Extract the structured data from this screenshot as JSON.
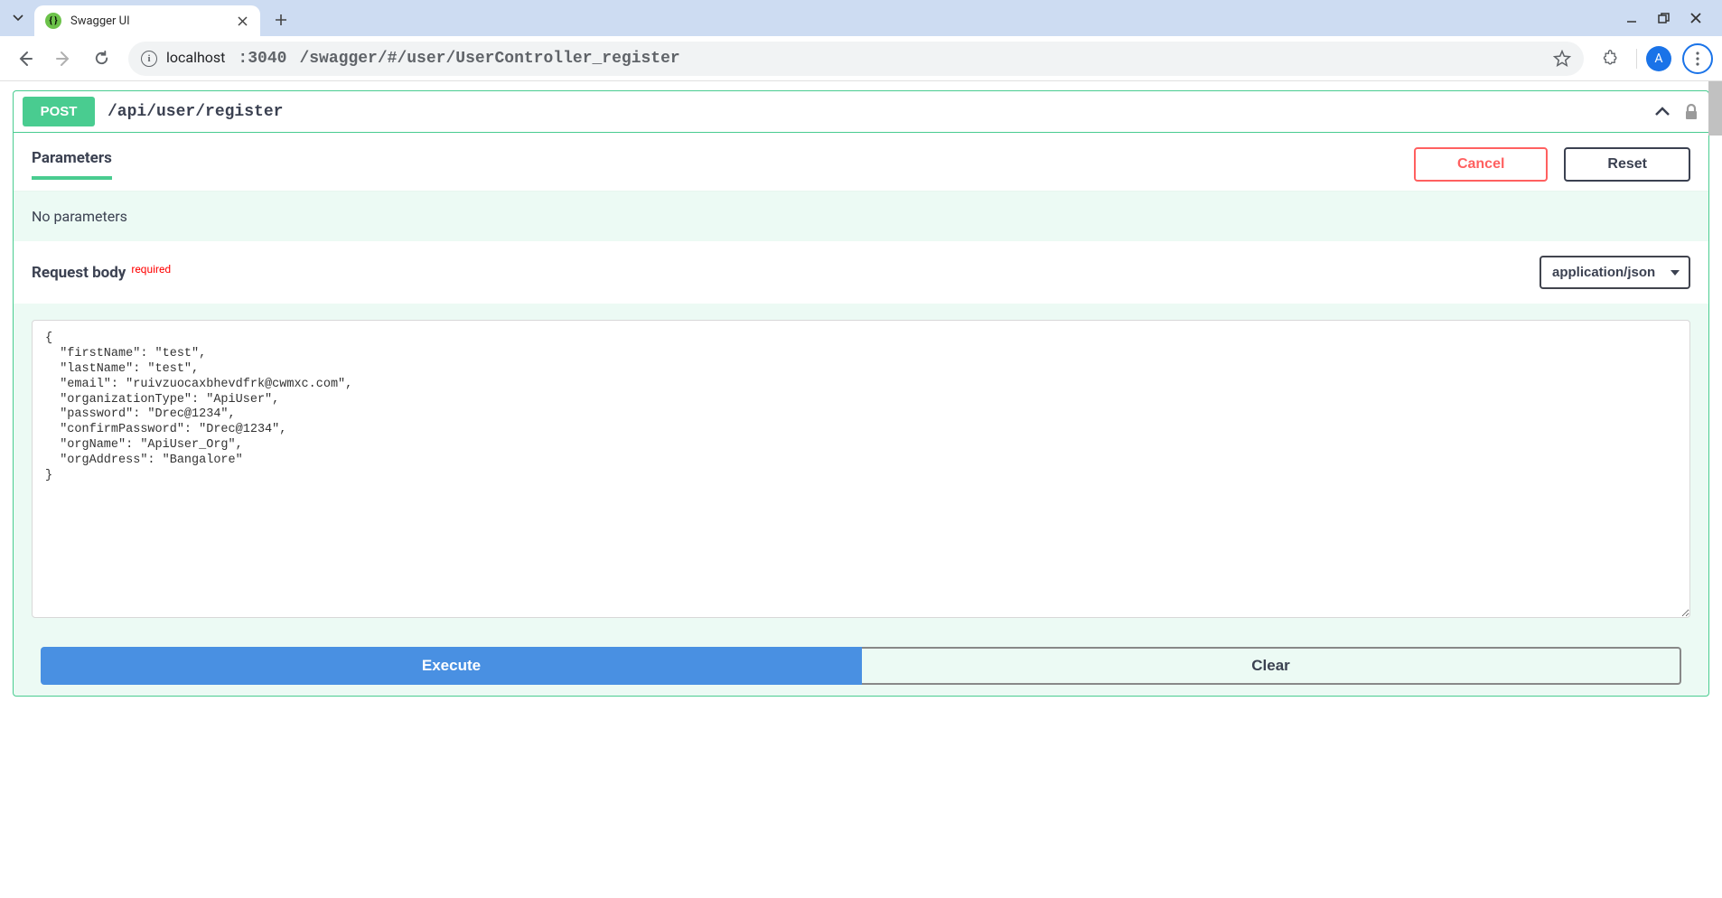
{
  "browser": {
    "tab_title": "Swagger UI",
    "url_host": "localhost",
    "url_port": ":3040",
    "url_path": "/swagger/#/user/UserController_register",
    "avatar_letter": "A"
  },
  "operation": {
    "method": "POST",
    "path": "/api/user/register"
  },
  "parameters": {
    "title": "Parameters",
    "cancel_label": "Cancel",
    "reset_label": "Reset",
    "no_params_text": "No parameters"
  },
  "request_body": {
    "title": "Request body",
    "required_label": "required",
    "content_type": "application/json",
    "body_text": "{\n  \"firstName\": \"test\",\n  \"lastName\": \"test\",\n  \"email\": \"ruivzuocaxbhevdfrk@cwmxc.com\",\n  \"organizationType\": \"ApiUser\",\n  \"password\": \"Drec@1234\",\n  \"confirmPassword\": \"Drec@1234\",\n  \"orgName\": \"ApiUser_Org\",\n  \"orgAddress\": \"Bangalore\"\n}"
  },
  "actions": {
    "execute_label": "Execute",
    "clear_label": "Clear"
  }
}
